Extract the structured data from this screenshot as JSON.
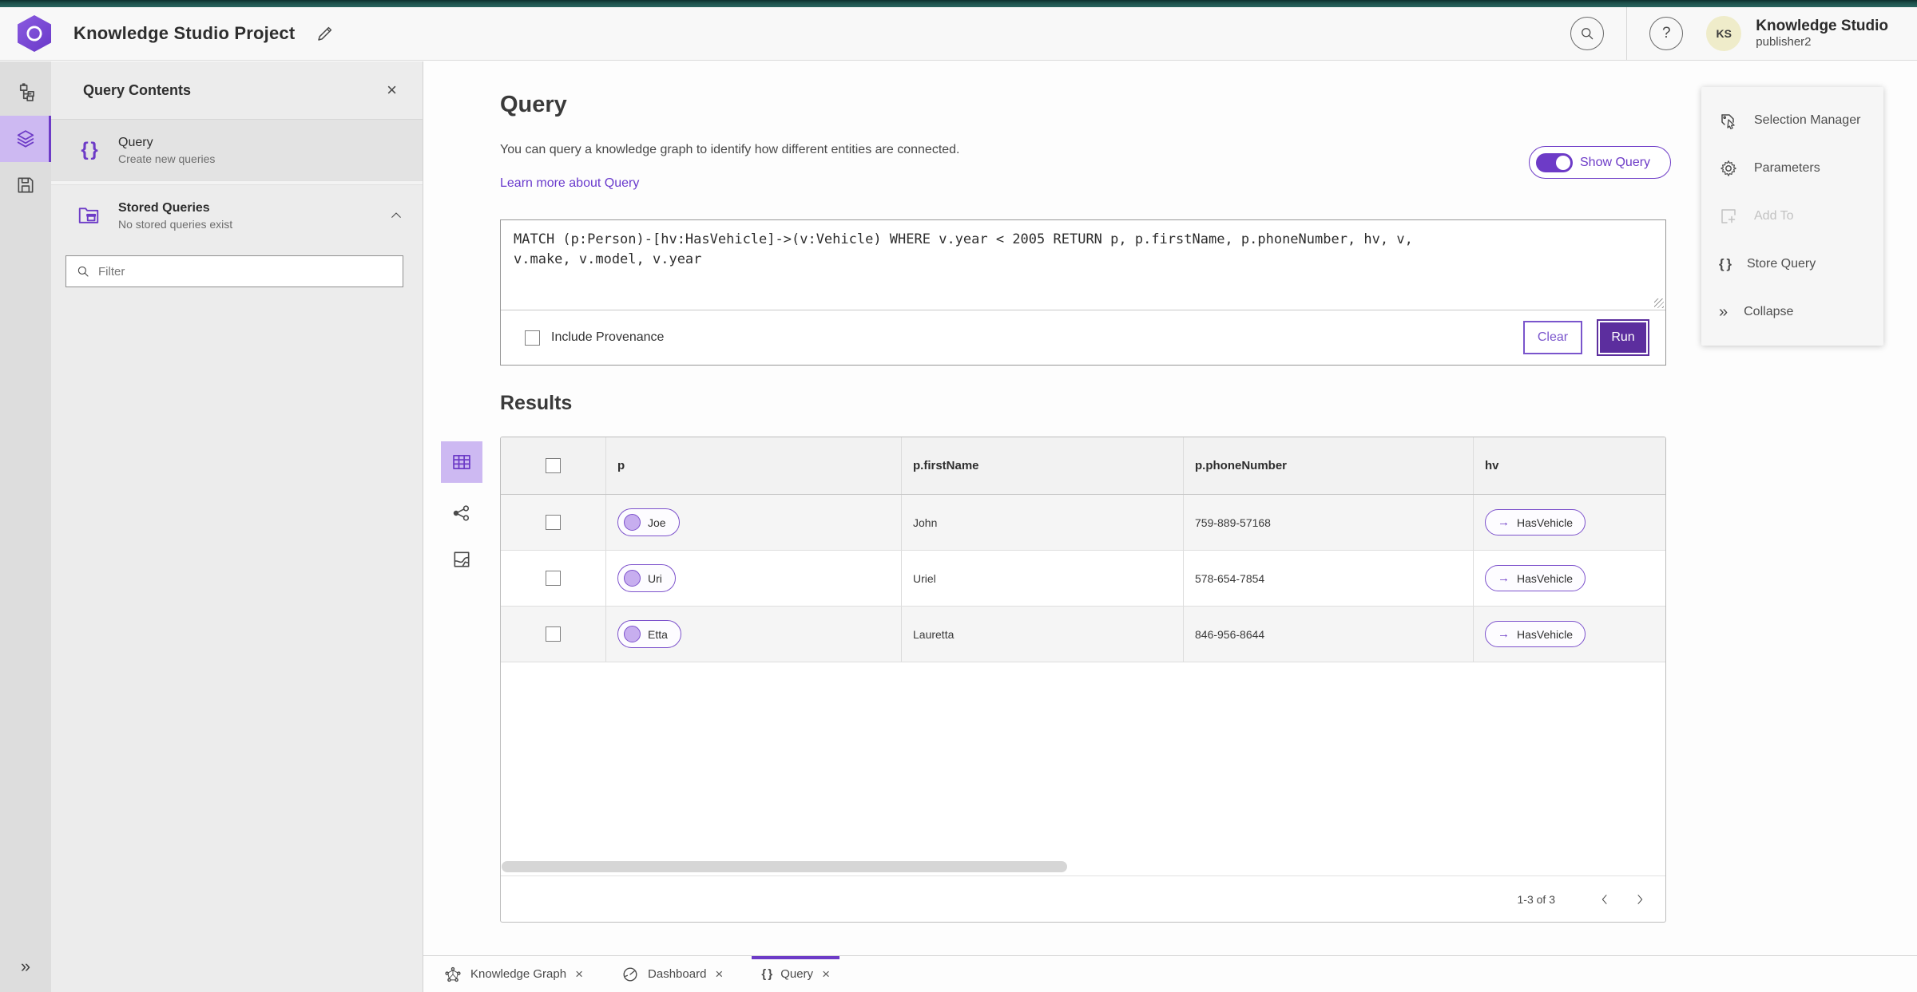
{
  "glyphs": {
    "close": "×",
    "help": "?",
    "braces": "{ }",
    "double_chevron_right": "»",
    "arrow_right": "→"
  },
  "colors": {
    "accent_purple": "#6d3bc7",
    "run_button_purple": "#5c2e9e",
    "selected_light_purple": "#cdb9f2",
    "top_bar_teal": "#1e524d",
    "avatar_yellow": "#efecca"
  },
  "header": {
    "title": "Knowledge Studio Project",
    "user_name": "Knowledge Studio",
    "user_role": "publisher2",
    "avatar_initials": "KS"
  },
  "panel": {
    "title": "Query Contents",
    "query_item": {
      "label": "Query",
      "description": "Create new queries"
    },
    "stored_queries": {
      "label": "Stored Queries",
      "description": "No stored queries exist"
    },
    "filter_placeholder": "Filter"
  },
  "main": {
    "title": "Query",
    "description": "You can query a knowledge graph to identify how different entities are connected.",
    "learn_more": "Learn more about Query",
    "show_query_label": "Show Query",
    "query_text": "MATCH (p:Person)-[hv:HasVehicle]->(v:Vehicle) WHERE v.year < 2005 RETURN p, p.firstName, p.phoneNumber, hv, v,\nv.make, v.model, v.year",
    "include_provenance_label": "Include Provenance",
    "clear_label": "Clear",
    "run_label": "Run",
    "results_title": "Results"
  },
  "table": {
    "columns": [
      "p",
      "p.firstName",
      "p.phoneNumber",
      "hv"
    ],
    "rows": [
      {
        "p": "Joe",
        "firstName": "John",
        "phoneNumber": "759-889-57168",
        "hv": "HasVehicle"
      },
      {
        "p": "Uri",
        "firstName": "Uriel",
        "phoneNumber": "578-654-7854",
        "hv": "HasVehicle"
      },
      {
        "p": "Etta",
        "firstName": "Lauretta",
        "phoneNumber": "846-956-8644",
        "hv": "HasVehicle"
      }
    ],
    "pagination": "1-3 of 3"
  },
  "context_menu": {
    "items": [
      {
        "label": "Selection Manager",
        "disabled": false
      },
      {
        "label": "Parameters",
        "disabled": false
      },
      {
        "label": "Add To",
        "disabled": true
      },
      {
        "label": "Store Query",
        "disabled": false
      },
      {
        "label": "Collapse",
        "disabled": false
      }
    ]
  },
  "tabs": {
    "items": [
      {
        "label": "Knowledge Graph",
        "active": false
      },
      {
        "label": "Dashboard",
        "active": false
      },
      {
        "label": "Query",
        "active": true
      }
    ]
  }
}
